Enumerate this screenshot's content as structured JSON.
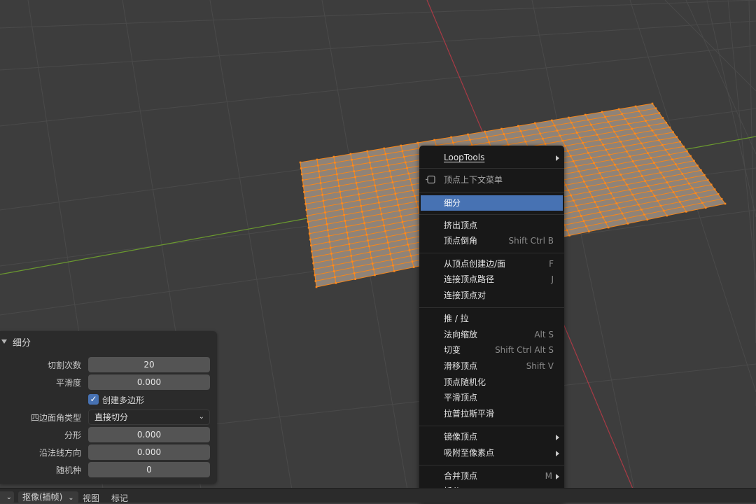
{
  "operator_panel": {
    "title": "细分",
    "number_of_cuts": {
      "label": "切割次数",
      "value": "20"
    },
    "smoothness": {
      "label": "平滑度",
      "value": "0.000"
    },
    "create_ngons": {
      "label": "创建多边形",
      "checked": true
    },
    "quad_corner_type": {
      "label": "四边面角类型",
      "value": "直接切分"
    },
    "fractal": {
      "label": "分形",
      "value": "0.000"
    },
    "along_normal": {
      "label": "沿法线方向",
      "value": "0.000"
    },
    "random_seed": {
      "label": "随机种",
      "value": "0"
    }
  },
  "context_menu": {
    "items": [
      {
        "label": "LoopTools",
        "submenu": true
      },
      {
        "label": "顶点上下文菜单",
        "icon": "pin-icon"
      },
      {
        "label": "细分",
        "highlighted": true
      },
      {
        "label": "挤出顶点"
      },
      {
        "label": "顶点倒角",
        "shortcut": "Shift Ctrl B"
      },
      {
        "label": "从顶点创建边/面",
        "shortcut": "F"
      },
      {
        "label": "连接顶点路径",
        "shortcut": "J"
      },
      {
        "label": "连接顶点对"
      },
      {
        "label": "推 / 拉"
      },
      {
        "label": "法向缩放",
        "shortcut": "Alt S"
      },
      {
        "label": "切变",
        "shortcut": "Shift Ctrl Alt S"
      },
      {
        "label": "滑移顶点",
        "shortcut": "Shift V"
      },
      {
        "label": "顶点随机化"
      },
      {
        "label": "平滑顶点"
      },
      {
        "label": "拉普拉斯平滑"
      },
      {
        "label": "镜像顶点",
        "submenu": true
      },
      {
        "label": "吸附至像素点",
        "submenu": true
      },
      {
        "label": "合并顶点",
        "shortcut": "M"
      },
      {
        "label": "拆分",
        "shortcut": "Y"
      }
    ]
  },
  "bottom_bar": {
    "first_dropdown": "",
    "camera_dropdown": "抠像(插帧)",
    "view_label": "视图",
    "marker_label": "标记"
  },
  "colors": {
    "viewport_bg": "#3d3d3d",
    "grid": "#4a4a4a",
    "x_axis": "#a83a45",
    "y_axis": "#6b9a2f",
    "mesh_fill": "#8f8378",
    "mesh_wire": "#f5861a",
    "highlight": "#4772b3"
  },
  "mesh": {
    "cuts": 20
  }
}
